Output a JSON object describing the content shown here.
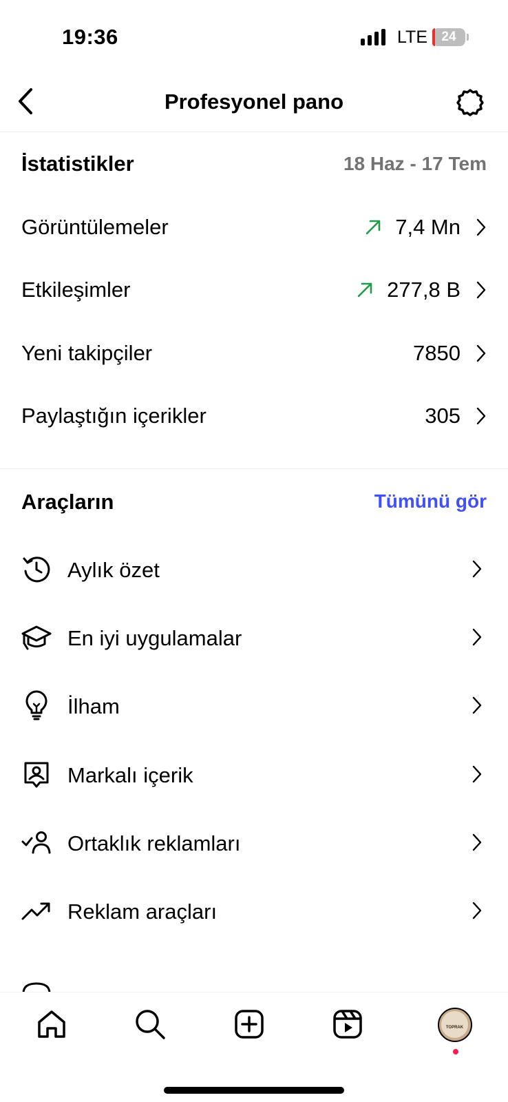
{
  "status_bar": {
    "time": "19:36",
    "network": "LTE",
    "battery": "24",
    "battery_level": 0.24,
    "battery_color": "#bdbdbd",
    "battery_low_color": "#e5302b"
  },
  "header": {
    "title": "Profesyonel pano",
    "back_icon": "chevron-left-icon",
    "settings_icon": "gear-icon"
  },
  "stats": {
    "title": "İstatistikler",
    "date_range": "18 Haz - 17 Tem",
    "rows": [
      {
        "label": "Görüntülemeler",
        "value": "7,4 Mn",
        "trend": "up"
      },
      {
        "label": "Etkileşimler",
        "value": "277,8 B",
        "trend": "up"
      },
      {
        "label": "Yeni takipçiler",
        "value": "7850",
        "trend": "none"
      },
      {
        "label": "Paylaştığın içerikler",
        "value": "305",
        "trend": "none"
      }
    ],
    "trend_color": "#1f9a4a"
  },
  "tools": {
    "title": "Araçların",
    "see_all": "Tümünü gör",
    "see_all_color": "#4150f7",
    "items": [
      {
        "label": "Aylık özet",
        "icon": "history-clock-icon"
      },
      {
        "label": "En iyi uygulamalar",
        "icon": "graduation-cap-icon"
      },
      {
        "label": "İlham",
        "icon": "lightbulb-icon"
      },
      {
        "label": "Markalı içerik",
        "icon": "branded-content-icon"
      },
      {
        "label": "Ortaklık reklamları",
        "icon": "partner-check-icon"
      },
      {
        "label": "Reklam araçları",
        "icon": "trending-up-icon"
      }
    ]
  },
  "bottom_nav": {
    "items": [
      "home-icon",
      "search-icon",
      "create-plus-icon",
      "reels-icon",
      "profile-avatar"
    ],
    "avatar_text": "TOPRAK"
  }
}
